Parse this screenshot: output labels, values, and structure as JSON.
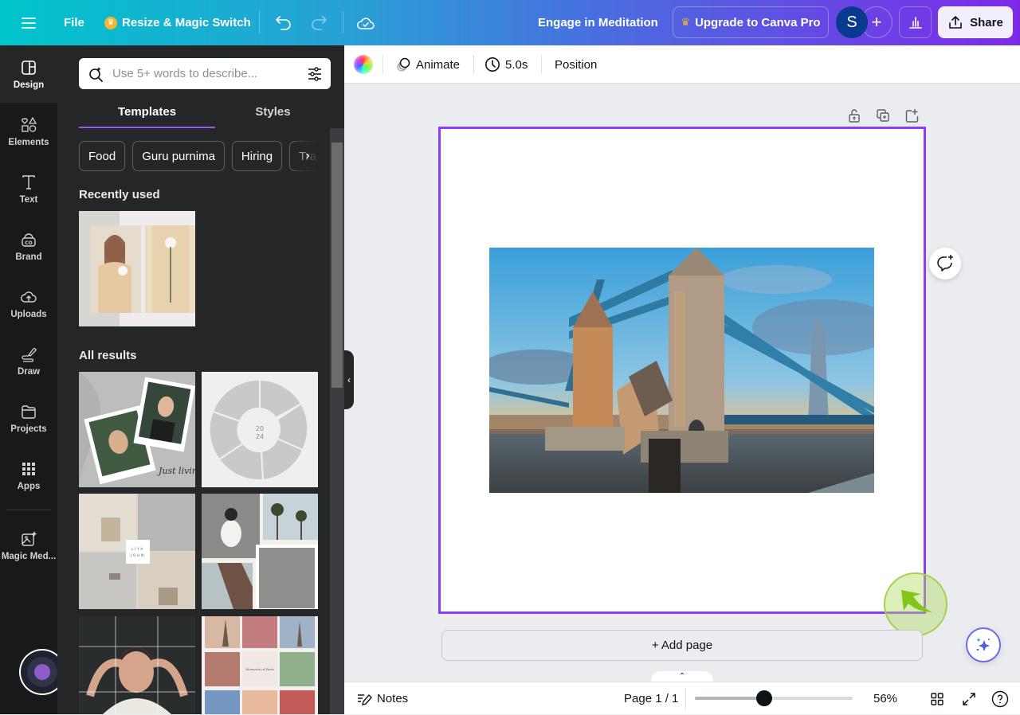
{
  "topbar": {
    "menu_icon": "hamburger-icon",
    "file_label": "File",
    "resize_label": "Resize & Magic Switch",
    "design_title": "Engage in Meditation",
    "upgrade_label": "Upgrade to Canva Pro",
    "avatar_initial": "S",
    "add_collaborator": "+",
    "share_label": "Share",
    "colors": {
      "gradient_start": "#00c4cc",
      "gradient_end": "#7d2ae8"
    }
  },
  "rail": {
    "items": [
      {
        "label": "Design",
        "icon": "design-layout-icon",
        "active": true
      },
      {
        "label": "Elements",
        "icon": "shapes-icon"
      },
      {
        "label": "Text",
        "icon": "text-icon"
      },
      {
        "label": "Brand",
        "icon": "brand-kit-icon"
      },
      {
        "label": "Uploads",
        "icon": "cloud-upload-icon"
      },
      {
        "label": "Draw",
        "icon": "pen-icon"
      },
      {
        "label": "Projects",
        "icon": "folder-icon"
      },
      {
        "label": "Apps",
        "icon": "apps-grid-icon"
      },
      {
        "label": "Magic Med...",
        "icon": "magic-media-icon"
      }
    ]
  },
  "panel": {
    "search_placeholder": "Use 5+ words to describe...",
    "search_value": "",
    "tabs": [
      {
        "label": "Templates",
        "active": true
      },
      {
        "label": "Styles",
        "active": false
      }
    ],
    "chips": [
      "Food",
      "Guru purnima",
      "Hiring",
      "Tra"
    ],
    "recently_used_title": "Recently used",
    "all_results_title": "All results",
    "recent_templates": [
      {
        "name": "beige-fashion-diptych-template"
      }
    ],
    "results": [
      {
        "name": "plant-portrait-polaroid-template",
        "caption": "Just living my best life"
      },
      {
        "name": "circular-sunglasses-collage-template",
        "caption": "20 24"
      },
      {
        "name": "coffee-hands-collage-template",
        "caption": "LIYA JOHN"
      },
      {
        "name": "beach-palm-collage-template"
      },
      {
        "name": "grid-portrait-template"
      },
      {
        "name": "paris-moments-collage-template",
        "caption": "Moments of Paris"
      }
    ]
  },
  "context_toolbar": {
    "color_icon": "color-wheel-icon",
    "animate_label": "Animate",
    "duration_label": "5.0s",
    "position_label": "Position"
  },
  "canvas": {
    "page_tools": [
      "lock-open-icon",
      "duplicate-page-icon",
      "add-page-icon"
    ],
    "image_alt": "Tower Bridge at sunset",
    "add_page_label": "+ Add page",
    "accent_color": "#8b3dff"
  },
  "footer": {
    "notes_label": "Notes",
    "page_indicator": "Page 1 / 1",
    "zoom_percent": 56,
    "zoom_label": "56%",
    "zoom_slider_fraction": 0.44
  }
}
